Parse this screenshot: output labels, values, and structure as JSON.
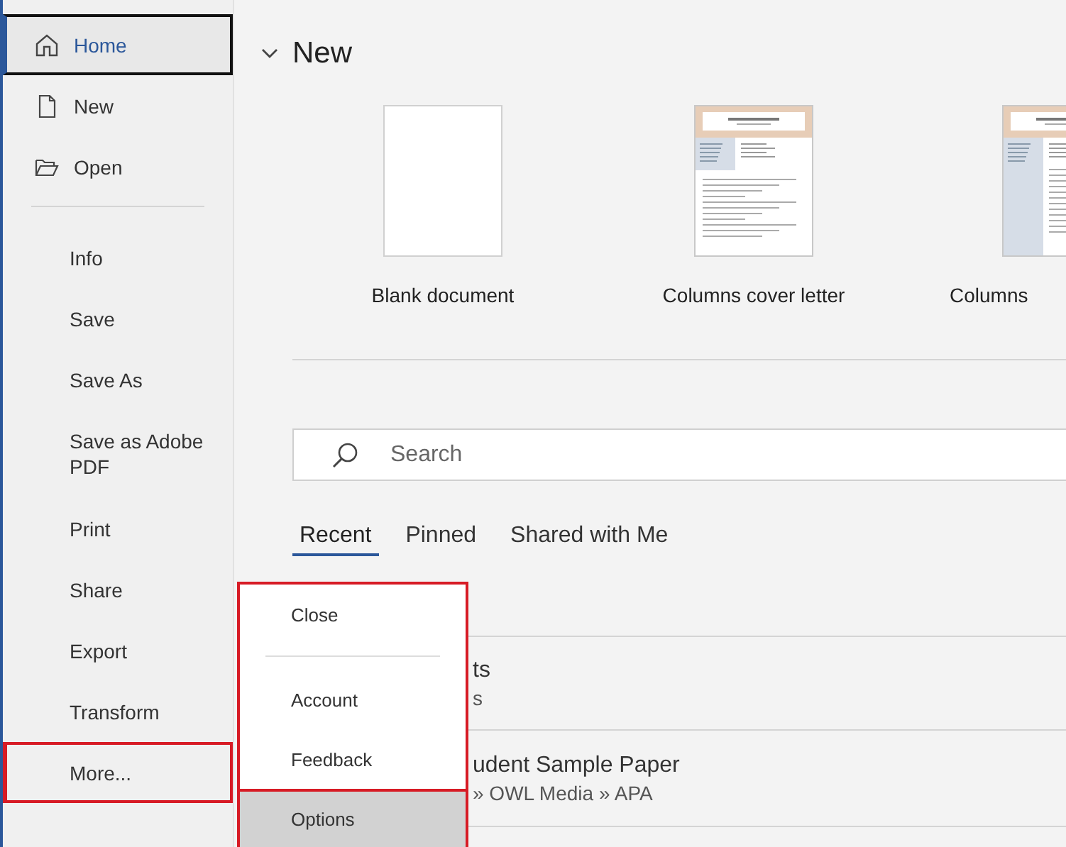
{
  "sidebar": {
    "top_items": [
      {
        "label": "Home",
        "selected": true,
        "highlighted": false
      },
      {
        "label": "New",
        "selected": false,
        "highlighted": false
      },
      {
        "label": "Open",
        "selected": false,
        "highlighted": false
      }
    ],
    "items": [
      {
        "label": "Info",
        "selected": false,
        "highlighted": false
      },
      {
        "label": "Save",
        "selected": false,
        "highlighted": false
      },
      {
        "label": "Save As",
        "selected": false,
        "highlighted": false
      },
      {
        "label": "Save as Adobe PDF",
        "selected": false,
        "highlighted": false
      },
      {
        "label": "Print",
        "selected": false,
        "highlighted": false
      },
      {
        "label": "Share",
        "selected": false,
        "highlighted": false
      },
      {
        "label": "Export",
        "selected": false,
        "highlighted": false
      },
      {
        "label": "Transform",
        "selected": false,
        "highlighted": false
      },
      {
        "label": "More...",
        "selected": false,
        "highlighted": true
      }
    ]
  },
  "main": {
    "heading": "New",
    "templates": [
      {
        "label": "Blank document",
        "kind": "blank"
      },
      {
        "label": "Columns cover letter",
        "kind": "letter"
      },
      {
        "label": "Columns",
        "kind": "resume"
      }
    ],
    "search": {
      "placeholder": "Search"
    },
    "tabs": [
      {
        "label": "Recent",
        "selected": true
      },
      {
        "label": "Pinned",
        "selected": false
      },
      {
        "label": "Shared with Me",
        "selected": false
      }
    ],
    "recent": [
      {
        "name": "ts",
        "path": "s"
      },
      {
        "name": "udent Sample Paper",
        "path": "» OWL Media » APA"
      }
    ]
  },
  "more_menu": {
    "items": [
      {
        "label": "Close",
        "selected": false,
        "highlighted": false,
        "separator_after": true
      },
      {
        "label": "Account",
        "selected": false,
        "highlighted": false
      },
      {
        "label": "Feedback",
        "selected": false,
        "highlighted": false
      },
      {
        "label": "Options",
        "selected": true,
        "highlighted": true
      }
    ]
  }
}
